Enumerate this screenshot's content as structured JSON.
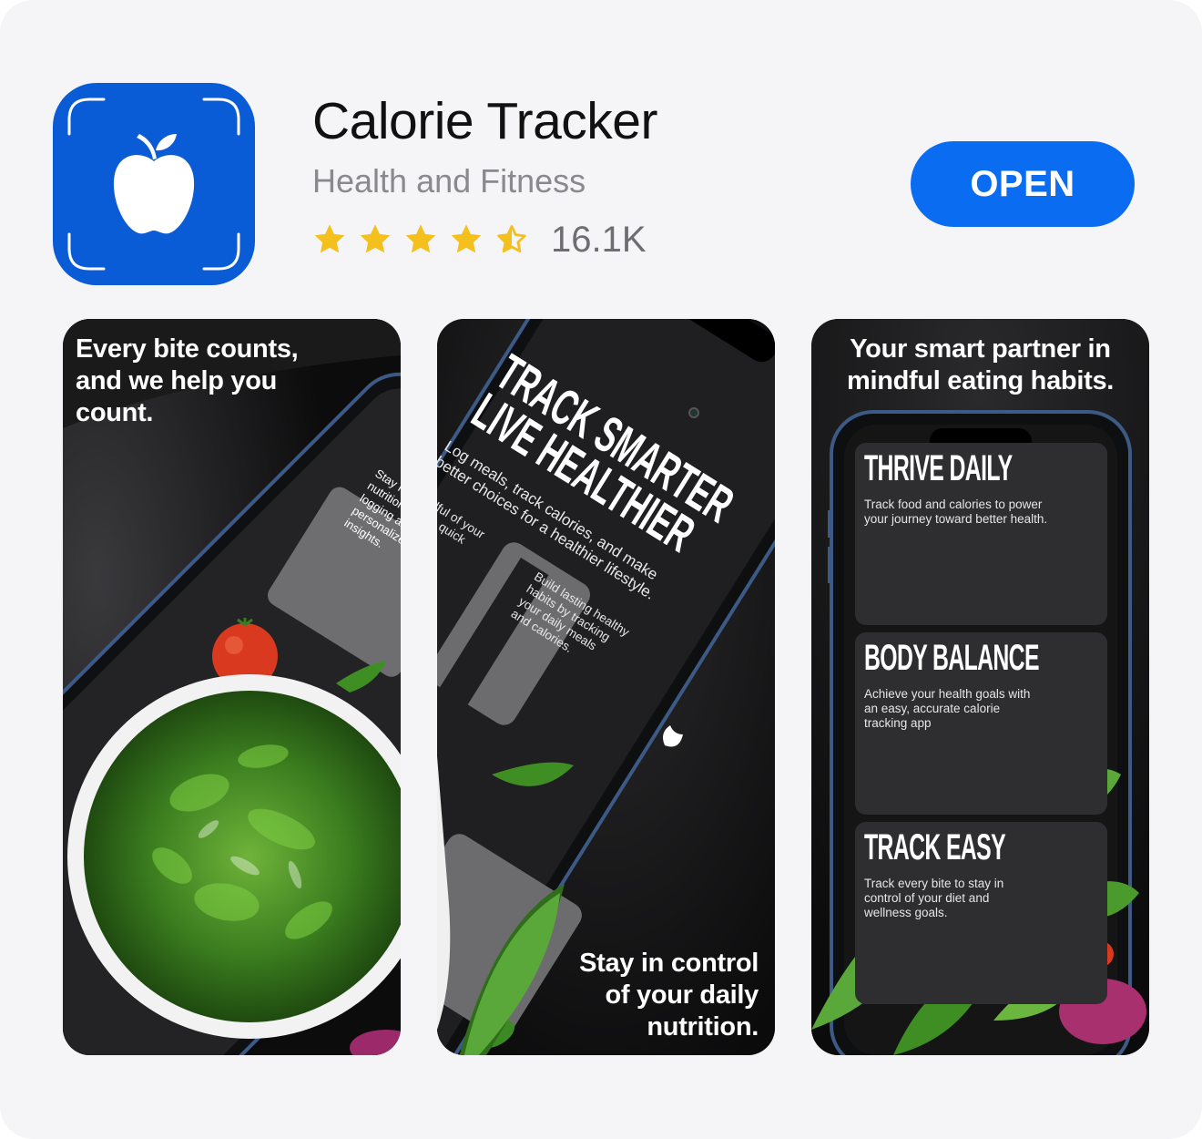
{
  "app": {
    "title": "Calorie Tracker",
    "category": "Health and Fitness",
    "rating_count": "16.1K",
    "rating": 4.5,
    "open_label": "OPEN",
    "icon": "apple-icon",
    "accent": "#0a6cf0",
    "icon_bg": "#0a5bd6",
    "star_color": "#f4c01e"
  },
  "screenshots": [
    {
      "caption_lines": [
        "Every bite counts,",
        "and we help you",
        "count."
      ],
      "card_text_lines": [
        "Stay mi",
        "nutrition",
        "logging an",
        "personalized",
        "insights."
      ]
    },
    {
      "headline_lines": [
        "TRACK SMARTER",
        "LIVE HEALTHIER"
      ],
      "sub_lines": [
        "Log meals, track calories, and make",
        "better choices for a healthier lifestyle."
      ],
      "card_a_lines": [
        "ndful of your",
        "with quick",
        "d"
      ],
      "card_b_lines": [
        "Build lasting healthy",
        "habits by tracking",
        "your daily meals",
        "and calories."
      ],
      "caption_lines": [
        "Stay in control",
        "of your daily",
        "nutrition."
      ]
    },
    {
      "caption_lines": [
        "Your smart partner in",
        "mindful eating habits."
      ],
      "panels": [
        {
          "title": "THRIVE DAILY",
          "desc_lines": [
            "Track food and calories to power",
            "your journey toward better health."
          ]
        },
        {
          "title": "BODY BALANCE",
          "desc_lines": [
            "Achieve your health goals with",
            "an easy, accurate calorie",
            "tracking app"
          ]
        },
        {
          "title": "TRACK EASY",
          "desc_lines": [
            "Track every bite to stay in",
            "control of your diet and",
            "wellness goals."
          ]
        }
      ]
    }
  ]
}
